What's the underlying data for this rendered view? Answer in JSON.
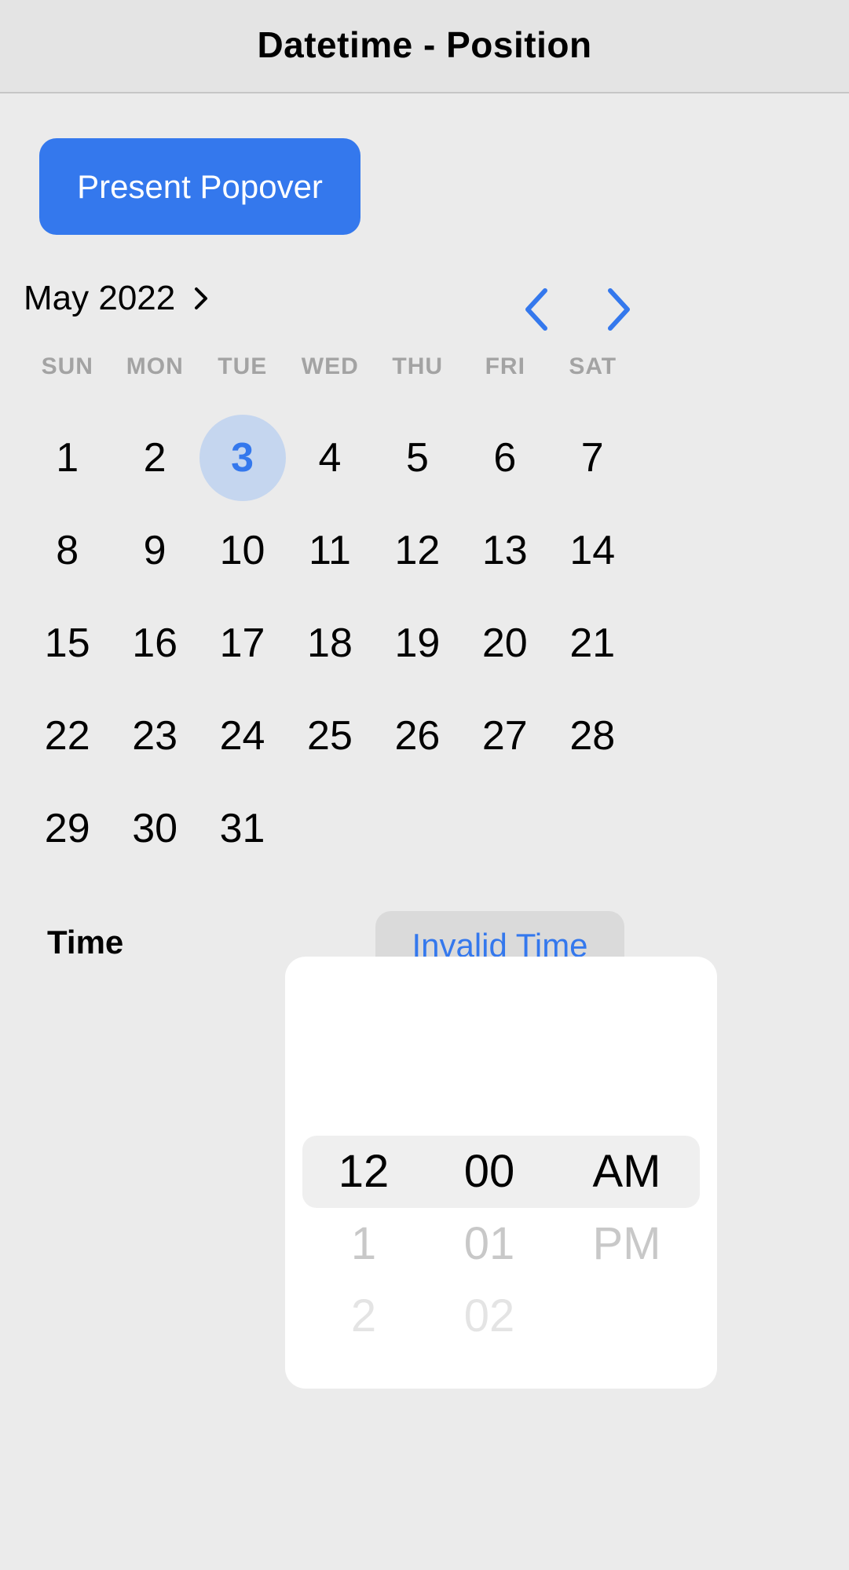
{
  "toolbar": {
    "title": "Datetime - Position"
  },
  "present_button": {
    "label": "Present Popover"
  },
  "calendar": {
    "month_year": "May 2022",
    "weekdays": [
      "SUN",
      "MON",
      "TUE",
      "WED",
      "THU",
      "FRI",
      "SAT"
    ],
    "weeks": [
      [
        "1",
        "2",
        "3",
        "4",
        "5",
        "6",
        "7"
      ],
      [
        "8",
        "9",
        "10",
        "11",
        "12",
        "13",
        "14"
      ],
      [
        "15",
        "16",
        "17",
        "18",
        "19",
        "20",
        "21"
      ],
      [
        "22",
        "23",
        "24",
        "25",
        "26",
        "27",
        "28"
      ],
      [
        "29",
        "30",
        "31",
        "",
        "",
        "",
        ""
      ]
    ],
    "selected_day": "3"
  },
  "time": {
    "label": "Time",
    "value": "Invalid Time"
  },
  "picker": {
    "hours": [
      "12",
      "1",
      "2",
      ""
    ],
    "minutes": [
      "00",
      "01",
      "02",
      ""
    ],
    "periods": [
      "AM",
      "PM",
      "",
      ""
    ]
  },
  "colors": {
    "accent": "#3478ed",
    "selected_day_bg": "#c5d6ef",
    "background": "#ebebeb",
    "weekday_text": "#a3a3a3"
  }
}
